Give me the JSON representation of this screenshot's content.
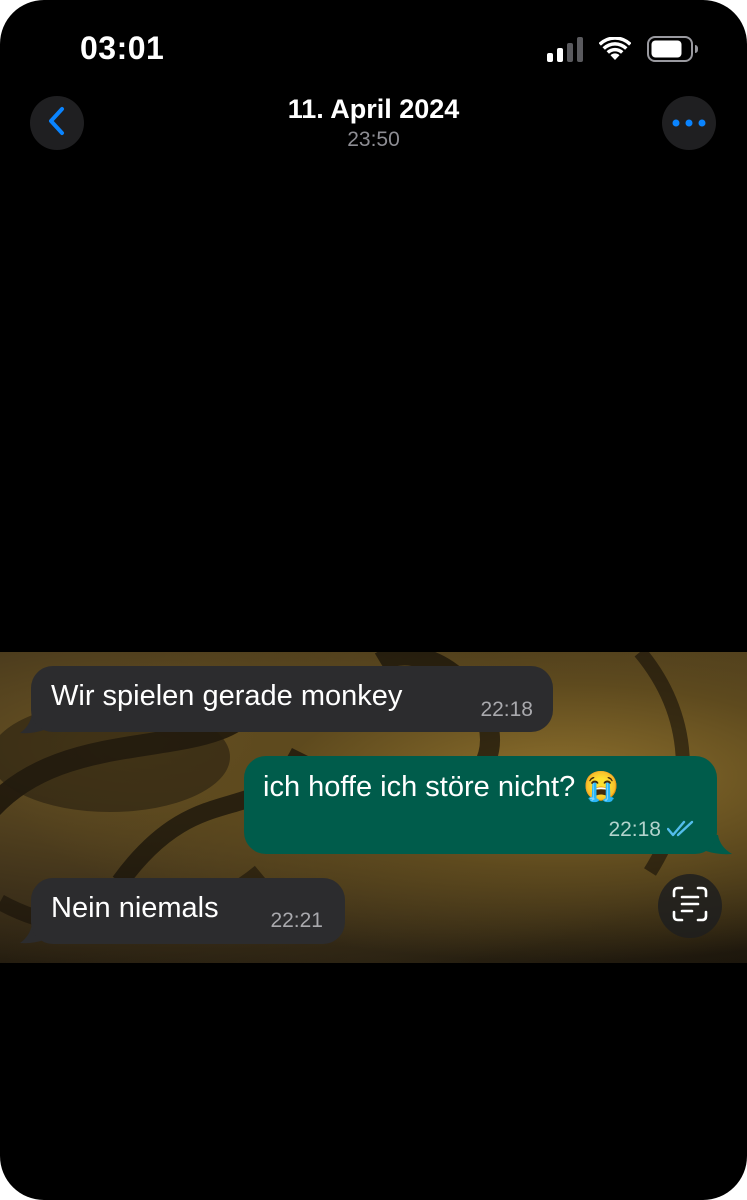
{
  "status_bar": {
    "time": "03:01",
    "icons": [
      "cellular-signal-icon",
      "wifi-icon",
      "battery-icon"
    ],
    "battery_level": 0.75
  },
  "header": {
    "back_icon": "chevron-left-icon",
    "title": "11. April 2024",
    "subtitle": "23:50",
    "more_icon": "ellipsis-icon"
  },
  "photo": {
    "messages": [
      {
        "direction": "incoming",
        "text": "Wir spielen gerade monkey",
        "time": "22:18"
      },
      {
        "direction": "outgoing",
        "text": "ich hoffe ich störe nicht? 😭",
        "time": "22:18",
        "status": "read"
      },
      {
        "direction": "incoming",
        "text": "Nein niemals",
        "time": "22:21"
      }
    ],
    "live_text_icon": "live-text-scan-icon"
  },
  "colors": {
    "accent": "#0a84ff",
    "incoming_bubble": "#2c2c2e",
    "outgoing_bubble": "#005c4b",
    "read_ticks": "#53bdeb",
    "background": "#000000"
  }
}
